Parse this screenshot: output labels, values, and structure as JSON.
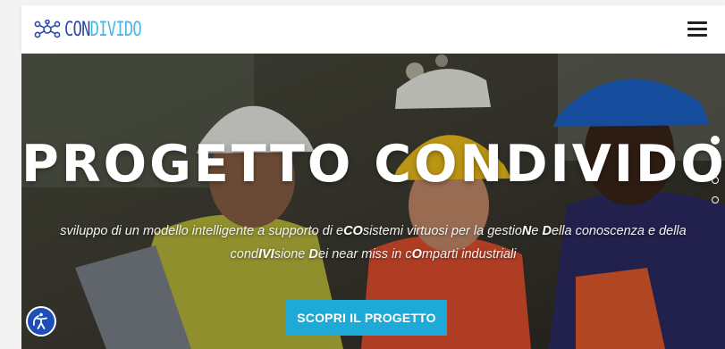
{
  "header": {
    "logo_text_a": "CON",
    "logo_text_b": "DIVIDO",
    "menu_icon": "hamburger-menu-icon"
  },
  "hero": {
    "title": "PROGETTO CONDIVIDO",
    "subtitle_parts": [
      {
        "t": "sviluppo di un modello intelligente a supporto di e",
        "b": false
      },
      {
        "t": "CO",
        "b": true
      },
      {
        "t": "sistemi virtuosi per la gestio",
        "b": false
      },
      {
        "t": "N",
        "b": true
      },
      {
        "t": "e ",
        "b": false
      },
      {
        "t": "D",
        "b": true
      },
      {
        "t": "ella conoscenza e della cond",
        "b": false
      },
      {
        "t": "IVI",
        "b": true
      },
      {
        "t": "sione ",
        "b": false
      },
      {
        "t": "D",
        "b": true
      },
      {
        "t": "ei near miss in c",
        "b": false
      },
      {
        "t": "O",
        "b": true
      },
      {
        "t": "mparti industriali",
        "b": false
      }
    ],
    "cta_label": "SCOPRI IL PROGETTO",
    "slides": 4,
    "active_slide": 0
  },
  "accessibility": {
    "icon": "accessibility-icon"
  },
  "colors": {
    "brand": "#2b4aa8",
    "accent": "#1fa9d6",
    "access": "#1e4fb8"
  }
}
